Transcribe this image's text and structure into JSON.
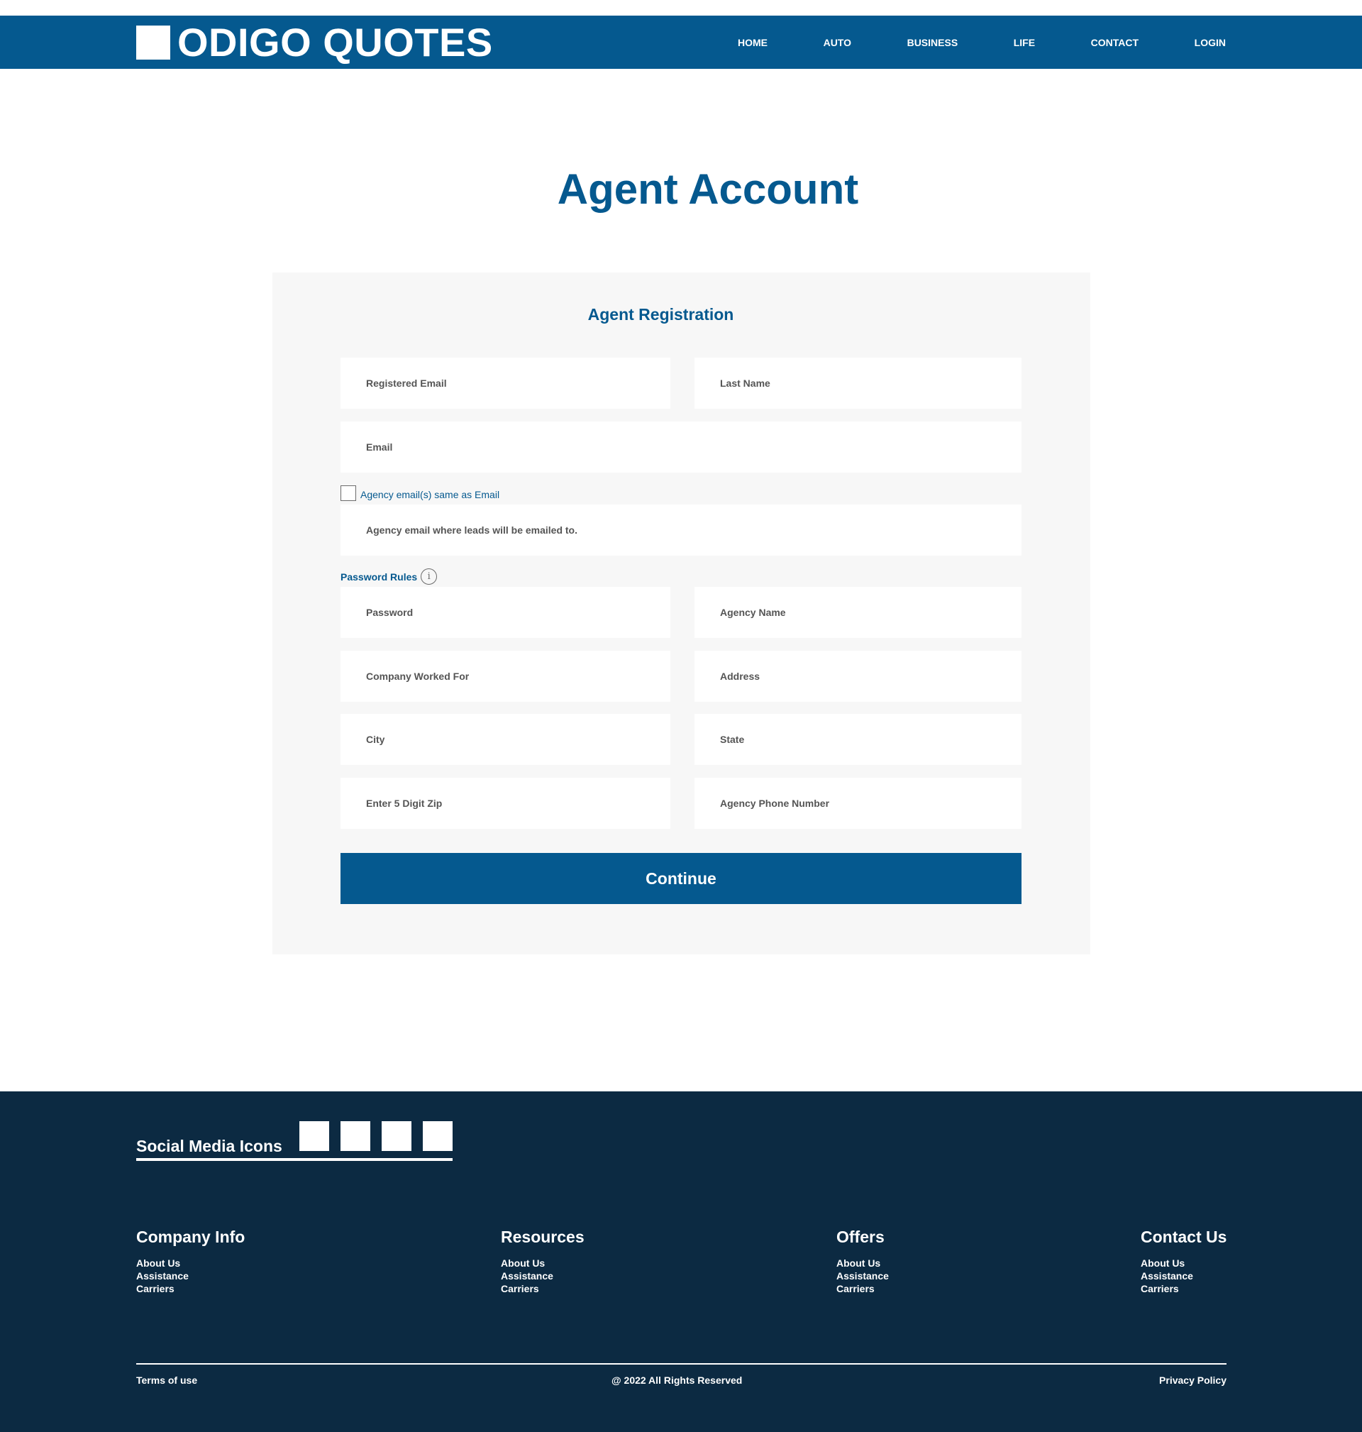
{
  "header": {
    "logo_text": "ODIGO QUOTES",
    "nav": [
      "HOME",
      "AUTO",
      "BUSINESS",
      "LIFE",
      "CONTACT",
      "LOGIN"
    ]
  },
  "page_title": "Agent Account",
  "form": {
    "title": "Agent Registration",
    "fields": {
      "registered_email": "Registered Email",
      "last_name": "Last Name",
      "email": "Email",
      "agency_email": "Agency email where leads will be emailed to.",
      "password": "Password",
      "agency_name": "Agency Name",
      "company_worked_for": "Company Worked For",
      "address": "Address",
      "city": "City",
      "state": "State",
      "zip": "Enter 5 Digit Zip",
      "agency_phone": "Agency Phone Number"
    },
    "checkbox_label": "Agency email(s) same as Email",
    "password_rules_label": "Password Rules",
    "info_glyph": "i",
    "continue_label": "Continue"
  },
  "footer": {
    "social_label": "Social Media Icons",
    "columns": [
      {
        "title": "Company Info",
        "links": [
          "About Us",
          "Assistance",
          "Carriers"
        ]
      },
      {
        "title": "Resources",
        "links": [
          "About Us",
          "Assistance",
          "Carriers"
        ]
      },
      {
        "title": "Offers",
        "links": [
          "About Us",
          "Assistance",
          "Carriers"
        ]
      },
      {
        "title": "Contact Us",
        "links": [
          "About Us",
          "Assistance",
          "Carriers"
        ]
      }
    ],
    "terms": "Terms of use",
    "copyright": "@ 2022 All Rights Reserved",
    "privacy": "Privacy Policy"
  },
  "colors": {
    "brand_blue": "#05598f",
    "footer_navy": "#0c2a42",
    "card_bg": "#f7f7f7"
  }
}
